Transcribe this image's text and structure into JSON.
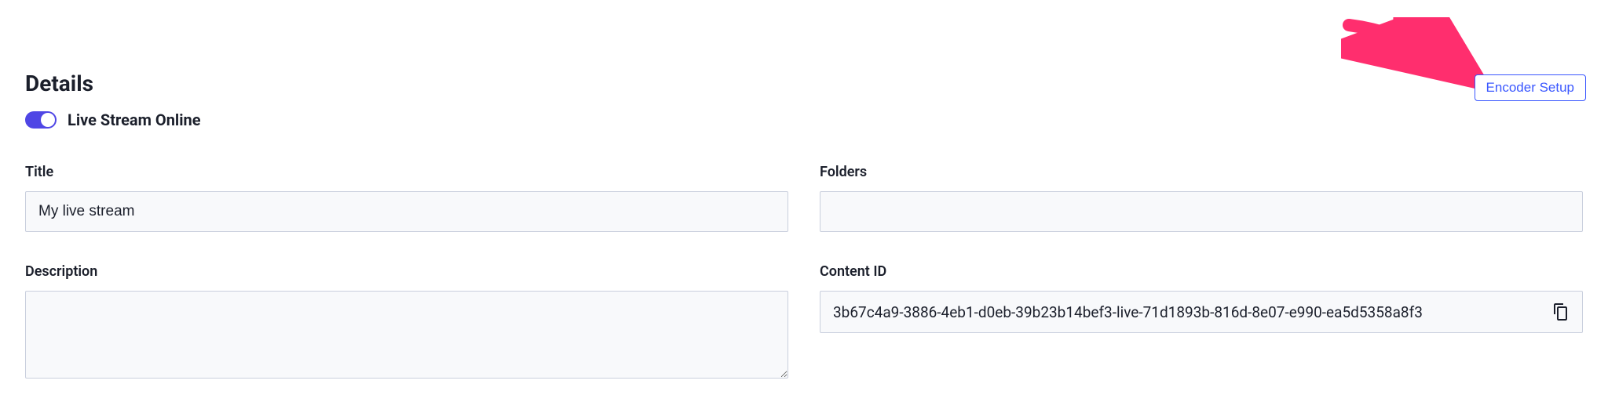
{
  "section_title": "Details",
  "encoder_button_label": "Encoder Setup",
  "toggle": {
    "label": "Live Stream Online",
    "on": true
  },
  "fields": {
    "title": {
      "label": "Title",
      "value": "My live stream"
    },
    "description": {
      "label": "Description",
      "value": ""
    },
    "folders": {
      "label": "Folders",
      "value": ""
    },
    "content_id": {
      "label": "Content ID",
      "value": "3b67c4a9-3886-4eb1-d0eb-39b23b14bef3-live-71d1893b-816d-8e07-e990-ea5d5358a8f3"
    }
  },
  "icons": {
    "copy": "copy-icon"
  },
  "annotation": {
    "arrow_color": "#ff2e6e"
  }
}
